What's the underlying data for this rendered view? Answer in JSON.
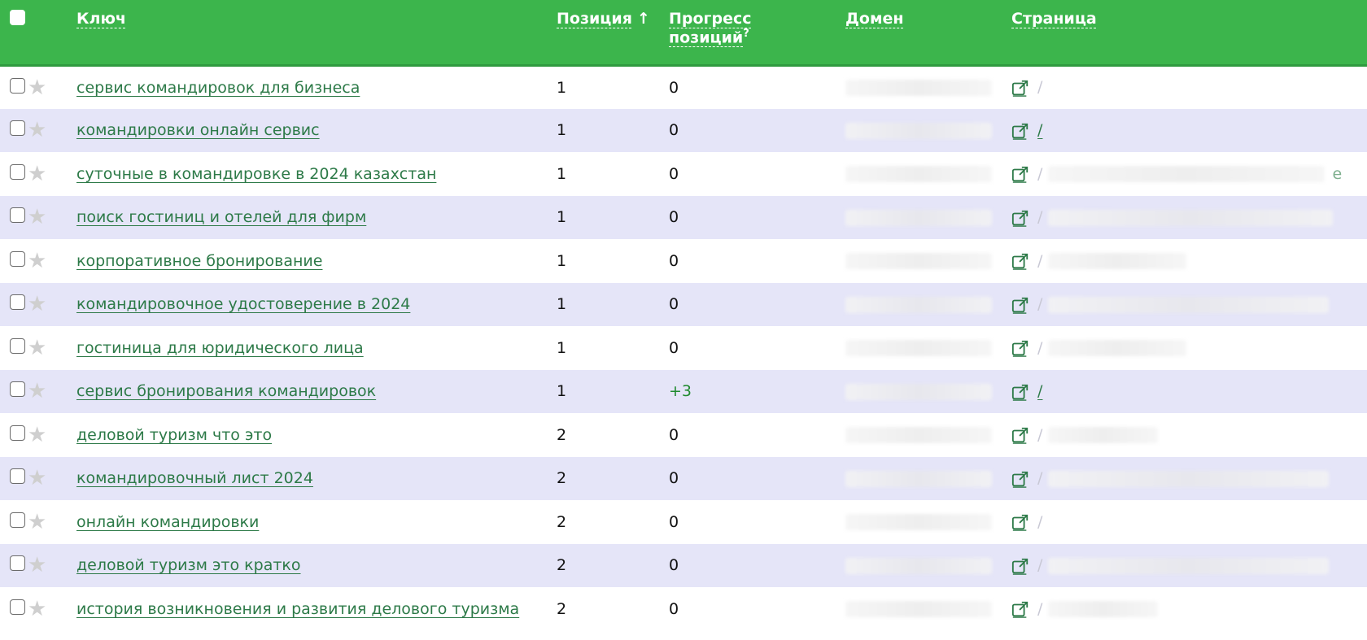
{
  "header": {
    "key": "Ключ",
    "position": "Позиция",
    "position_sort": "↑",
    "progress_line1": "Прогресс",
    "progress_line2": "позиций",
    "progress_help": "?",
    "domain": "Домен",
    "page": "Страница"
  },
  "colors": {
    "header_bg": "#3cb54c",
    "link": "#2d7a48",
    "row_alt": "#e5e5f8",
    "positive": "#1f8a2e"
  },
  "rows": [
    {
      "keyword": "сервис командировок для бизнеса",
      "position": "1",
      "progress": "0",
      "page_text": "/",
      "page_visible": false
    },
    {
      "keyword": "командировки онлайн сервис",
      "position": "1",
      "progress": "0",
      "page_text": "/",
      "page_visible": true
    },
    {
      "keyword": "суточные в командировке в 2024 казахстан",
      "position": "1",
      "progress": "0",
      "page_text": "e",
      "page_visible": false
    },
    {
      "keyword": "поиск гостиниц и отелей для фирм",
      "position": "1",
      "progress": "0",
      "page_text": "",
      "page_visible": false
    },
    {
      "keyword": "корпоративное бронирование",
      "position": "1",
      "progress": "0",
      "page_text": "",
      "page_visible": false
    },
    {
      "keyword": "командировочное удостоверение в 2024",
      "position": "1",
      "progress": "0",
      "page_text": "",
      "page_visible": false
    },
    {
      "keyword": "гостиница для юридического лица",
      "position": "1",
      "progress": "0",
      "page_text": "",
      "page_visible": false
    },
    {
      "keyword": "сервис бронирования командировок",
      "position": "1",
      "progress": "+3",
      "page_text": "/",
      "page_visible": true
    },
    {
      "keyword": "деловой туризм что это",
      "position": "2",
      "progress": "0",
      "page_text": "",
      "page_visible": false
    },
    {
      "keyword": "командировочный лист 2024",
      "position": "2",
      "progress": "0",
      "page_text": "",
      "page_visible": false
    },
    {
      "keyword": "онлайн командировки",
      "position": "2",
      "progress": "0",
      "page_text": "",
      "page_visible": false
    },
    {
      "keyword": "деловой туризм это кратко",
      "position": "2",
      "progress": "0",
      "page_text": "",
      "page_visible": false
    },
    {
      "keyword": "история возникновения и развития делового туризма",
      "position": "2",
      "progress": "0",
      "page_text": "",
      "page_visible": false
    }
  ],
  "icons": {
    "star": "star-icon",
    "external": "external-link-icon"
  }
}
